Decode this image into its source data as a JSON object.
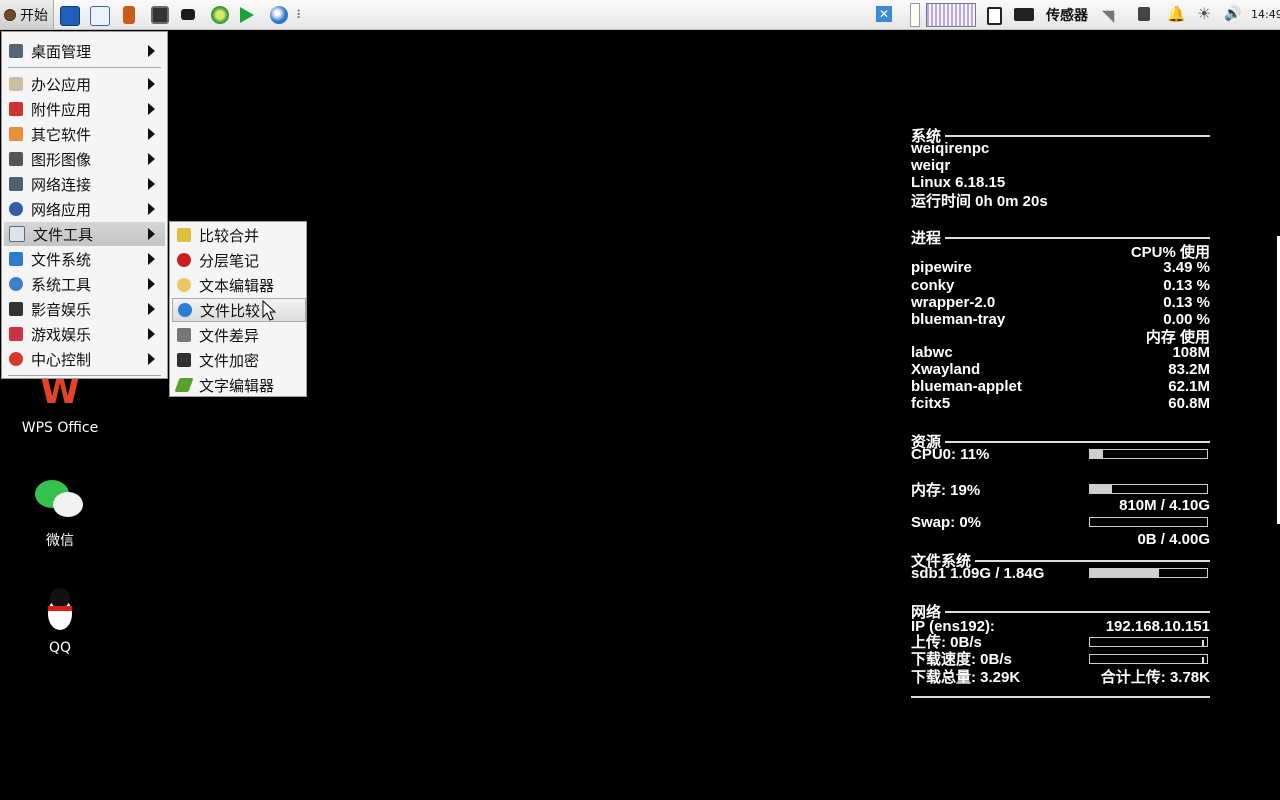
{
  "panel": {
    "start_label": "开始",
    "launchers": [
      "terminal-icon",
      "image-viewer-icon",
      "paint-icon",
      "monitor-icon",
      "display-icon",
      "disc-icon",
      "media-play-icon",
      "browser-icon"
    ],
    "grip": "⠇",
    "tray_sensor_label": "传感器",
    "clock": "14:49"
  },
  "menu": {
    "items": [
      {
        "label": "桌面管理",
        "icon": "desktop-icon",
        "color": "#556677"
      },
      {
        "label": "办公应用",
        "icon": "office-icon",
        "color": "#c8c0a0"
      },
      {
        "label": "附件应用",
        "icon": "accessories-icon",
        "color": "#cc3333"
      },
      {
        "label": "其它软件",
        "icon": "other-icon",
        "color": "#e8903a"
      },
      {
        "label": "图形图像",
        "icon": "graphics-icon",
        "color": "#555555"
      },
      {
        "label": "网络连接",
        "icon": "network-connect-icon",
        "color": "#506070"
      },
      {
        "label": "网络应用",
        "icon": "network-app-icon",
        "color": "#2e5fa8"
      },
      {
        "label": "文件工具",
        "icon": "file-tools-icon",
        "color": "#dde3ea"
      },
      {
        "label": "文件系统",
        "icon": "filesystem-icon",
        "color": "#2d7bcf"
      },
      {
        "label": "系统工具",
        "icon": "system-tools-icon",
        "color": "#3a7fd0"
      },
      {
        "label": "影音娱乐",
        "icon": "media-icon",
        "color": "#333333"
      },
      {
        "label": "游戏娱乐",
        "icon": "games-icon",
        "color": "#cc3344"
      },
      {
        "label": "中心控制",
        "icon": "power-icon",
        "color": "#d23a2a"
      }
    ],
    "submenu": [
      {
        "label": "比较合并",
        "icon": "compare-merge-icon",
        "color": "#e0c040"
      },
      {
        "label": "分层笔记",
        "icon": "cherry-notes-icon",
        "color": "#c82020"
      },
      {
        "label": "文本编辑器",
        "icon": "text-editor-icon",
        "color": "#e8c860"
      },
      {
        "label": "文件比较",
        "icon": "file-compare-icon",
        "color": "#2a7fd0"
      },
      {
        "label": "文件差异",
        "icon": "file-diff-icon",
        "color": "#777777"
      },
      {
        "label": "文件加密",
        "icon": "lock-icon",
        "color": "#333333"
      },
      {
        "label": "文字编辑器",
        "icon": "word-editor-icon",
        "color": "#5aa030"
      }
    ]
  },
  "desktop": {
    "wps_glyph": "W",
    "wps_label": "WPS Office",
    "wechat_label": "微信",
    "qq_label": "QQ"
  },
  "conky": {
    "system": {
      "title": "系统",
      "host": "weiqirenpc",
      "user": "weiqr",
      "kernel": "Linux 6.18.15",
      "uptime": "运行时间 0h 0m 20s"
    },
    "processes": {
      "title": "进程",
      "cpu_header": "CPU% 使用",
      "cpu_rows": [
        {
          "name": "pipewire",
          "value": "3.49 %"
        },
        {
          "name": "conky",
          "value": "0.13 %"
        },
        {
          "name": "wrapper-2.0",
          "value": "0.13 %"
        },
        {
          "name": "blueman-tray",
          "value": "0.00 %"
        }
      ],
      "mem_header": "内存 使用",
      "mem_rows": [
        {
          "name": "labwc",
          "value": "108M"
        },
        {
          "name": "Xwayland",
          "value": "83.2M"
        },
        {
          "name": "blueman-applet",
          "value": "62.1M"
        },
        {
          "name": "fcitx5",
          "value": "60.8M"
        }
      ]
    },
    "resources": {
      "title": "资源",
      "cpu_label": "CPU0: 11%",
      "cpu_fraction": 0.11,
      "mem_label": "内存: 19%",
      "mem_fraction": 0.19,
      "mem_detail": "810M / 4.10G",
      "swap_label": "Swap: 0%",
      "swap_fraction": 0.0,
      "swap_detail": "0B / 4.00G"
    },
    "filesystem": {
      "title": "文件系统",
      "label": "sdb1 1.09G / 1.84G",
      "fraction": 0.59
    },
    "network": {
      "title": "网络",
      "ip_label": "IP (ens192):",
      "ip": "192.168.10.151",
      "upload_label": "上传: 0B/s",
      "download_label": "下载速度: 0B/s",
      "download_total": "下载总量: 3.29K",
      "upload_total": "合计上传: 3.78K"
    }
  }
}
